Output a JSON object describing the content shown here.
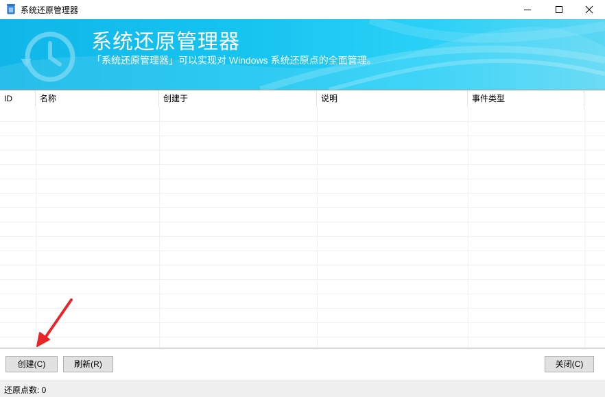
{
  "window": {
    "title": "系统还原管理器",
    "icons": {
      "app": "recycle-bin-icon",
      "minimize": "minimize-icon",
      "maximize": "maximize-icon",
      "close": "close-icon"
    }
  },
  "banner": {
    "title": "系统还原管理器",
    "subtitle": "「系统还原管理器」可以实现对 Windows 系统还原点的全面管理。",
    "icon": "clock-restore-icon",
    "colors": {
      "start": "#10b6e8",
      "end": "#5ad7f4",
      "text": "#ffffff"
    }
  },
  "table": {
    "columns": [
      "ID",
      "名称",
      "创建于",
      "说明",
      "事件类型"
    ],
    "rows": []
  },
  "buttons": {
    "create": "创建(C)",
    "refresh": "刷新(R)",
    "close": "关闭(C)"
  },
  "status": {
    "text": "还原点数: 0"
  },
  "annotation": {
    "arrow_color": "#e8262a"
  }
}
